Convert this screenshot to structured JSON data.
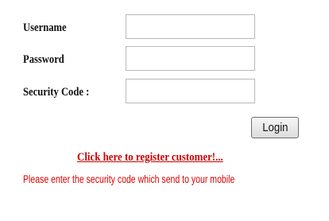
{
  "form": {
    "username_label": "Username",
    "username_value": "",
    "password_label": "Password",
    "password_value": "",
    "security_code_label": "Security Code :",
    "security_code_value": "",
    "login_label": "Login"
  },
  "register_link": "Click here to register customer!...",
  "security_message": "Please enter the security code which send to your mobile",
  "colors": {
    "label_text": "#111111",
    "link": "#cc0000",
    "message": "#dd0000",
    "input_border": "#b8b8b8"
  }
}
